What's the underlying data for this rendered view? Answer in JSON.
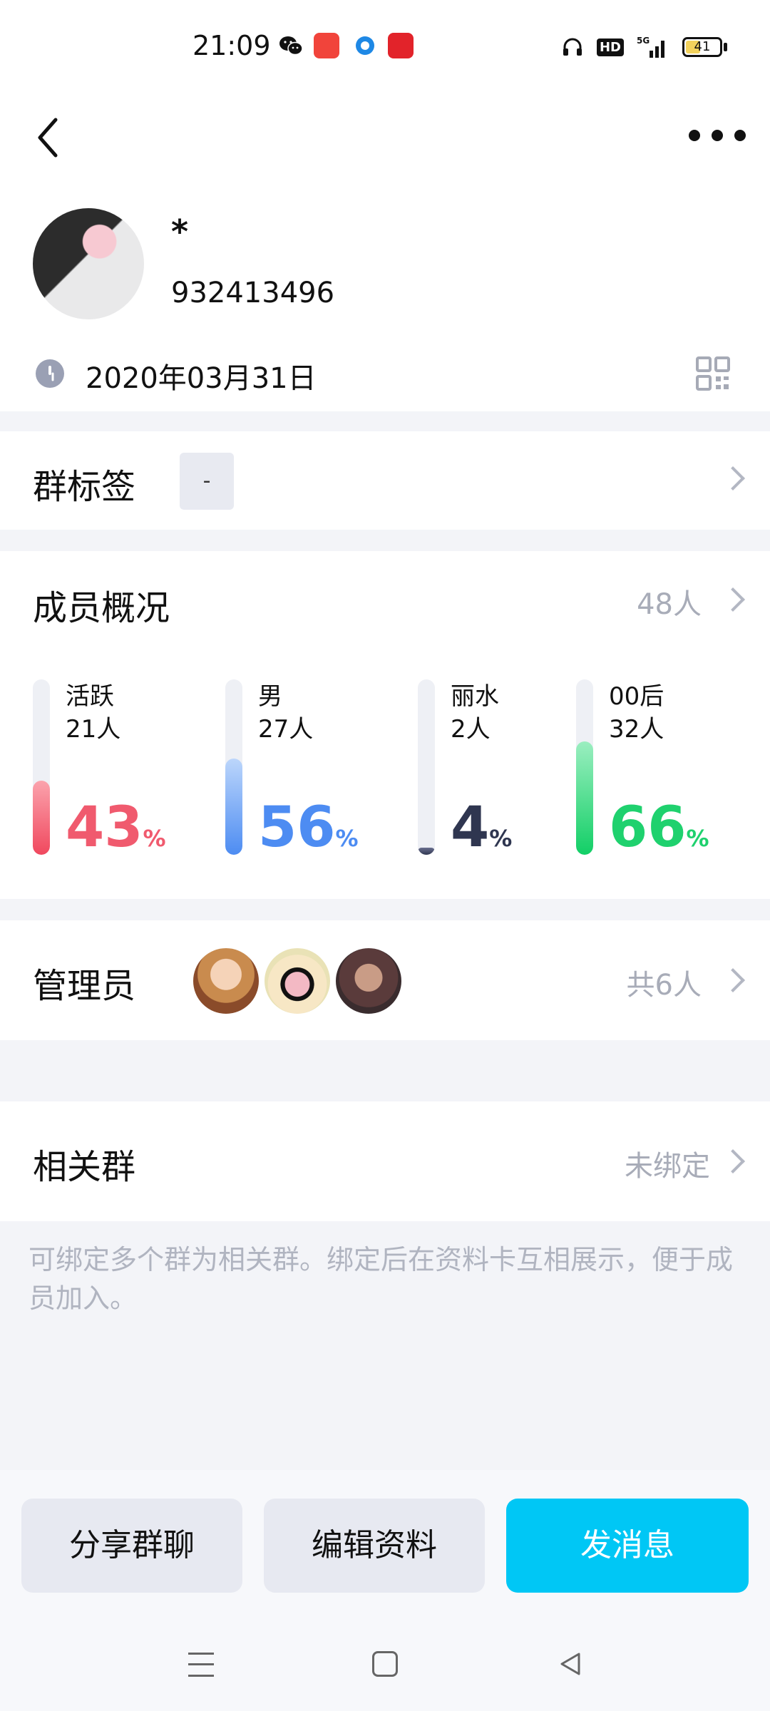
{
  "status_bar": {
    "time": "21:09",
    "battery": "41",
    "network": "5G",
    "hd_label": "HD",
    "icons": [
      "wechat-icon",
      "app-icon",
      "app-icon",
      "app-icon",
      "headphones-icon",
      "hd-icon",
      "signal-icon",
      "battery-icon"
    ]
  },
  "header": {
    "back_icon": "chevron-left-icon",
    "more_icon": "more-dots-icon",
    "group_name": "*",
    "group_id": "932413496",
    "created_date": "2020年03月31日",
    "qr_icon": "qr-code-icon"
  },
  "tags": {
    "title": "群标签",
    "value": "-"
  },
  "members": {
    "title": "成员概况",
    "total": "48人",
    "stats": [
      {
        "label": "活跃",
        "count": "21人",
        "percent": "43",
        "unit": "%",
        "fraction": 0.43,
        "color": "#f05a6e",
        "gradient": [
          "#fba3ad",
          "#f0485e"
        ]
      },
      {
        "label": "男",
        "count": "27人",
        "percent": "56",
        "unit": "%",
        "fraction": 0.56,
        "color": "#4d8cf2",
        "gradient": [
          "#bcd6fb",
          "#4d8cf2"
        ]
      },
      {
        "label": "丽水",
        "count": "2人",
        "percent": "4",
        "unit": "%",
        "fraction": 0.04,
        "color": "#2f3650",
        "gradient": [
          "#6b7190",
          "#2f3650"
        ]
      },
      {
        "label": "00后",
        "count": "32人",
        "percent": "66",
        "unit": "%",
        "fraction": 0.66,
        "color": "#1fd16e",
        "gradient": [
          "#9beec0",
          "#12cf66"
        ]
      }
    ]
  },
  "admins": {
    "title": "管理员",
    "count": "共6人"
  },
  "related": {
    "title": "相关群",
    "status": "未绑定",
    "hint": "可绑定多个群为相关群。绑定后在资料卡互相展示，便于成员加入。"
  },
  "actions": {
    "share": "分享群聊",
    "edit": "编辑资料",
    "send": "发消息"
  },
  "nav": {
    "icons": [
      "menu-icon",
      "home-icon",
      "back-triangle-icon"
    ]
  }
}
